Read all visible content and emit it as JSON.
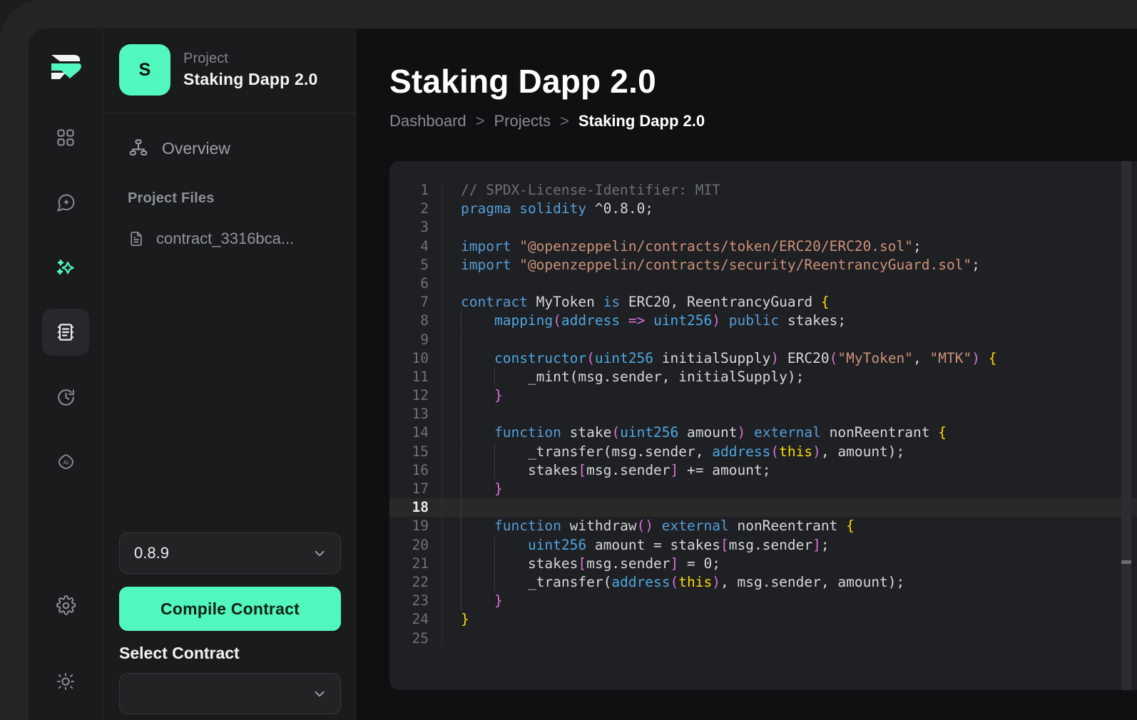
{
  "brand": {
    "logo_alt": "app-logo",
    "accent": "#52F7BD"
  },
  "rail": {
    "items": [
      {
        "name": "grid-icon",
        "label": "Dashboard",
        "state": "default"
      },
      {
        "name": "chat-plus-icon",
        "label": "New Chat",
        "state": "default"
      },
      {
        "name": "sparkles-icon",
        "label": "AI Assist",
        "state": "accent"
      },
      {
        "name": "contract-icon",
        "label": "Contracts",
        "state": "active"
      },
      {
        "name": "history-icon",
        "label": "History",
        "state": "default"
      },
      {
        "name": "ai-brain-icon",
        "label": "AI",
        "state": "default"
      }
    ],
    "bottom_items": [
      {
        "name": "gear-icon",
        "label": "Settings"
      },
      {
        "name": "sun-icon",
        "label": "Theme"
      }
    ]
  },
  "sidebar": {
    "project": {
      "avatar_initial": "S",
      "kicker": "Project",
      "title": "Staking Dapp 2.0"
    },
    "nav": [
      {
        "icon": "sitemap-icon",
        "label": "Overview"
      }
    ],
    "files_section_label": "Project Files",
    "files": [
      {
        "icon": "file-icon",
        "name": "contract_3316bca..."
      }
    ],
    "controls": {
      "compiler_version_value": "0.8.9",
      "compiler_version_options": [
        "0.8.9"
      ],
      "compile_button_label": "Compile Contract",
      "select_contract_label": "Select Contract",
      "select_contract_value": "",
      "select_contract_placeholder": ""
    }
  },
  "main": {
    "page_title": "Staking Dapp 2.0",
    "breadcrumb": [
      {
        "label": "Dashboard",
        "current": false
      },
      {
        "label": "Projects",
        "current": false
      },
      {
        "label": "Staking Dapp 2.0",
        "current": true
      }
    ],
    "breadcrumb_separator": ">"
  },
  "editor": {
    "language": "solidity",
    "active_line": 18,
    "total_lines": 25,
    "lines": [
      {
        "n": 1,
        "tokens": [
          {
            "t": "com",
            "v": "// SPDX-License-Identifier: MIT"
          }
        ]
      },
      {
        "n": 2,
        "tokens": [
          {
            "t": "key",
            "v": "pragma"
          },
          {
            "t": "pln",
            "v": " "
          },
          {
            "t": "key",
            "v": "solidity"
          },
          {
            "t": "pln",
            "v": " ^0.8.0;"
          }
        ]
      },
      {
        "n": 3,
        "tokens": []
      },
      {
        "n": 4,
        "tokens": [
          {
            "t": "key",
            "v": "import"
          },
          {
            "t": "pln",
            "v": " "
          },
          {
            "t": "str",
            "v": "\"@openzeppelin/contracts/token/ERC20/ERC20.sol\""
          },
          {
            "t": "pln",
            "v": ";"
          }
        ]
      },
      {
        "n": 5,
        "tokens": [
          {
            "t": "key",
            "v": "import"
          },
          {
            "t": "pln",
            "v": " "
          },
          {
            "t": "str",
            "v": "\"@openzeppelin/contracts/security/ReentrancyGuard.sol\""
          },
          {
            "t": "pln",
            "v": ";"
          }
        ]
      },
      {
        "n": 6,
        "tokens": []
      },
      {
        "n": 7,
        "tokens": [
          {
            "t": "key",
            "v": "contract"
          },
          {
            "t": "pln",
            "v": " MyToken "
          },
          {
            "t": "key",
            "v": "is"
          },
          {
            "t": "pln",
            "v": " ERC20, ReentrancyGuard "
          },
          {
            "t": "br1",
            "v": "{"
          }
        ]
      },
      {
        "n": 8,
        "indent": 1,
        "tokens": [
          {
            "t": "kw2",
            "v": "mapping"
          },
          {
            "t": "br2",
            "v": "("
          },
          {
            "t": "typ",
            "v": "address"
          },
          {
            "t": "pln",
            "v": " "
          },
          {
            "t": "par",
            "v": "=>"
          },
          {
            "t": "pln",
            "v": " "
          },
          {
            "t": "typ",
            "v": "uint256"
          },
          {
            "t": "br2",
            "v": ")"
          },
          {
            "t": "pln",
            "v": " "
          },
          {
            "t": "key",
            "v": "public"
          },
          {
            "t": "pln",
            "v": " stakes;"
          }
        ]
      },
      {
        "n": 9,
        "indent": 1,
        "tokens": []
      },
      {
        "n": 10,
        "indent": 1,
        "tokens": [
          {
            "t": "kw2",
            "v": "constructor"
          },
          {
            "t": "br2",
            "v": "("
          },
          {
            "t": "typ",
            "v": "uint256"
          },
          {
            "t": "pln",
            "v": " initialSupply"
          },
          {
            "t": "br2",
            "v": ")"
          },
          {
            "t": "pln",
            "v": " ERC20"
          },
          {
            "t": "br2",
            "v": "("
          },
          {
            "t": "str",
            "v": "\"MyToken\""
          },
          {
            "t": "pln",
            "v": ", "
          },
          {
            "t": "str",
            "v": "\"MTK\""
          },
          {
            "t": "br2",
            "v": ")"
          },
          {
            "t": "pln",
            "v": " "
          },
          {
            "t": "br1",
            "v": "{"
          }
        ]
      },
      {
        "n": 11,
        "indent": 2,
        "tokens": [
          {
            "t": "pln",
            "v": "_mint(msg.sender, initialSupply);"
          }
        ]
      },
      {
        "n": 12,
        "indent": 1,
        "tokens": [
          {
            "t": "br2",
            "v": "}"
          }
        ]
      },
      {
        "n": 13,
        "indent": 1,
        "tokens": []
      },
      {
        "n": 14,
        "indent": 1,
        "tokens": [
          {
            "t": "key",
            "v": "function"
          },
          {
            "t": "pln",
            "v": " stake"
          },
          {
            "t": "br2",
            "v": "("
          },
          {
            "t": "typ",
            "v": "uint256"
          },
          {
            "t": "pln",
            "v": " amount"
          },
          {
            "t": "br2",
            "v": ")"
          },
          {
            "t": "pln",
            "v": " "
          },
          {
            "t": "key",
            "v": "external"
          },
          {
            "t": "pln",
            "v": " nonReentrant "
          },
          {
            "t": "br1",
            "v": "{"
          }
        ]
      },
      {
        "n": 15,
        "indent": 2,
        "tokens": [
          {
            "t": "pln",
            "v": "_transfer(msg.sender, "
          },
          {
            "t": "kw2",
            "v": "address"
          },
          {
            "t": "br2",
            "v": "("
          },
          {
            "t": "this",
            "v": "this"
          },
          {
            "t": "br2",
            "v": ")"
          },
          {
            "t": "pln",
            "v": ", amount);"
          }
        ]
      },
      {
        "n": 16,
        "indent": 2,
        "tokens": [
          {
            "t": "pln",
            "v": "stakes"
          },
          {
            "t": "br2",
            "v": "["
          },
          {
            "t": "pln",
            "v": "msg.sender"
          },
          {
            "t": "br2",
            "v": "]"
          },
          {
            "t": "pln",
            "v": " += amount;"
          }
        ]
      },
      {
        "n": 17,
        "indent": 1,
        "tokens": [
          {
            "t": "br2",
            "v": "}"
          }
        ]
      },
      {
        "n": 18,
        "indent": 1,
        "tokens": []
      },
      {
        "n": 19,
        "indent": 1,
        "tokens": [
          {
            "t": "key",
            "v": "function"
          },
          {
            "t": "pln",
            "v": " withdraw"
          },
          {
            "t": "br2",
            "v": "()"
          },
          {
            "t": "pln",
            "v": " "
          },
          {
            "t": "key",
            "v": "external"
          },
          {
            "t": "pln",
            "v": " nonReentrant "
          },
          {
            "t": "br1",
            "v": "{"
          }
        ]
      },
      {
        "n": 20,
        "indent": 2,
        "tokens": [
          {
            "t": "typ",
            "v": "uint256"
          },
          {
            "t": "pln",
            "v": " amount = stakes"
          },
          {
            "t": "br2",
            "v": "["
          },
          {
            "t": "pln",
            "v": "msg.sender"
          },
          {
            "t": "br2",
            "v": "]"
          },
          {
            "t": "pln",
            "v": ";"
          }
        ]
      },
      {
        "n": 21,
        "indent": 2,
        "tokens": [
          {
            "t": "pln",
            "v": "stakes"
          },
          {
            "t": "br2",
            "v": "["
          },
          {
            "t": "pln",
            "v": "msg.sender"
          },
          {
            "t": "br2",
            "v": "]"
          },
          {
            "t": "pln",
            "v": " = 0;"
          }
        ]
      },
      {
        "n": 22,
        "indent": 2,
        "tokens": [
          {
            "t": "pln",
            "v": "_transfer("
          },
          {
            "t": "kw2",
            "v": "address"
          },
          {
            "t": "br2",
            "v": "("
          },
          {
            "t": "this",
            "v": "this"
          },
          {
            "t": "br2",
            "v": ")"
          },
          {
            "t": "pln",
            "v": ", msg.sender, amount);"
          }
        ]
      },
      {
        "n": 23,
        "indent": 1,
        "tokens": [
          {
            "t": "br2",
            "v": "}"
          }
        ]
      },
      {
        "n": 24,
        "tokens": [
          {
            "t": "br1",
            "v": "}"
          }
        ]
      },
      {
        "n": 25,
        "tokens": []
      }
    ]
  }
}
